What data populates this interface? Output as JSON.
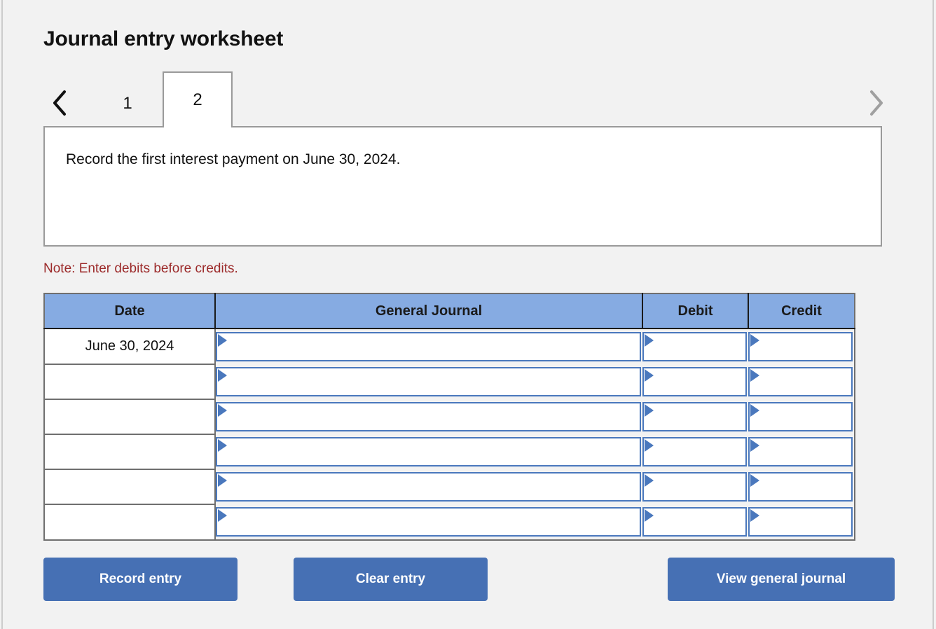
{
  "page": {
    "title": "Journal entry worksheet",
    "background_color": "#f2f2f2"
  },
  "pagination": {
    "prev_icon": "chevron-left-icon",
    "next_icon": "chevron-right-icon",
    "prev_enabled_color": "#111111",
    "next_enabled_color": "#a0a0a0",
    "tabs": [
      {
        "label": "1",
        "active": false
      },
      {
        "label": "2",
        "active": true
      }
    ],
    "active_tab": "2"
  },
  "prompt": {
    "text": "Record the first interest payment on June 30, 2024."
  },
  "note": {
    "text": "Note: Enter debits before credits.",
    "color": "#9c2a2a"
  },
  "journal": {
    "header_color": "#86abe2",
    "input_border_color": "#4a78bd",
    "columns": [
      {
        "key": "date",
        "label": "Date"
      },
      {
        "key": "general_journal",
        "label": "General Journal"
      },
      {
        "key": "debit",
        "label": "Debit"
      },
      {
        "key": "credit",
        "label": "Credit"
      }
    ],
    "rows": [
      {
        "date": "June 30, 2024",
        "general_journal": "",
        "debit": "",
        "credit": ""
      },
      {
        "date": "",
        "general_journal": "",
        "debit": "",
        "credit": ""
      },
      {
        "date": "",
        "general_journal": "",
        "debit": "",
        "credit": ""
      },
      {
        "date": "",
        "general_journal": "",
        "debit": "",
        "credit": ""
      },
      {
        "date": "",
        "general_journal": "",
        "debit": "",
        "credit": ""
      },
      {
        "date": "",
        "general_journal": "",
        "debit": "",
        "credit": ""
      }
    ]
  },
  "actions": {
    "button_color": "#4670b4",
    "record_label": "Record entry",
    "clear_label": "Clear entry",
    "view_label": "View general journal"
  }
}
